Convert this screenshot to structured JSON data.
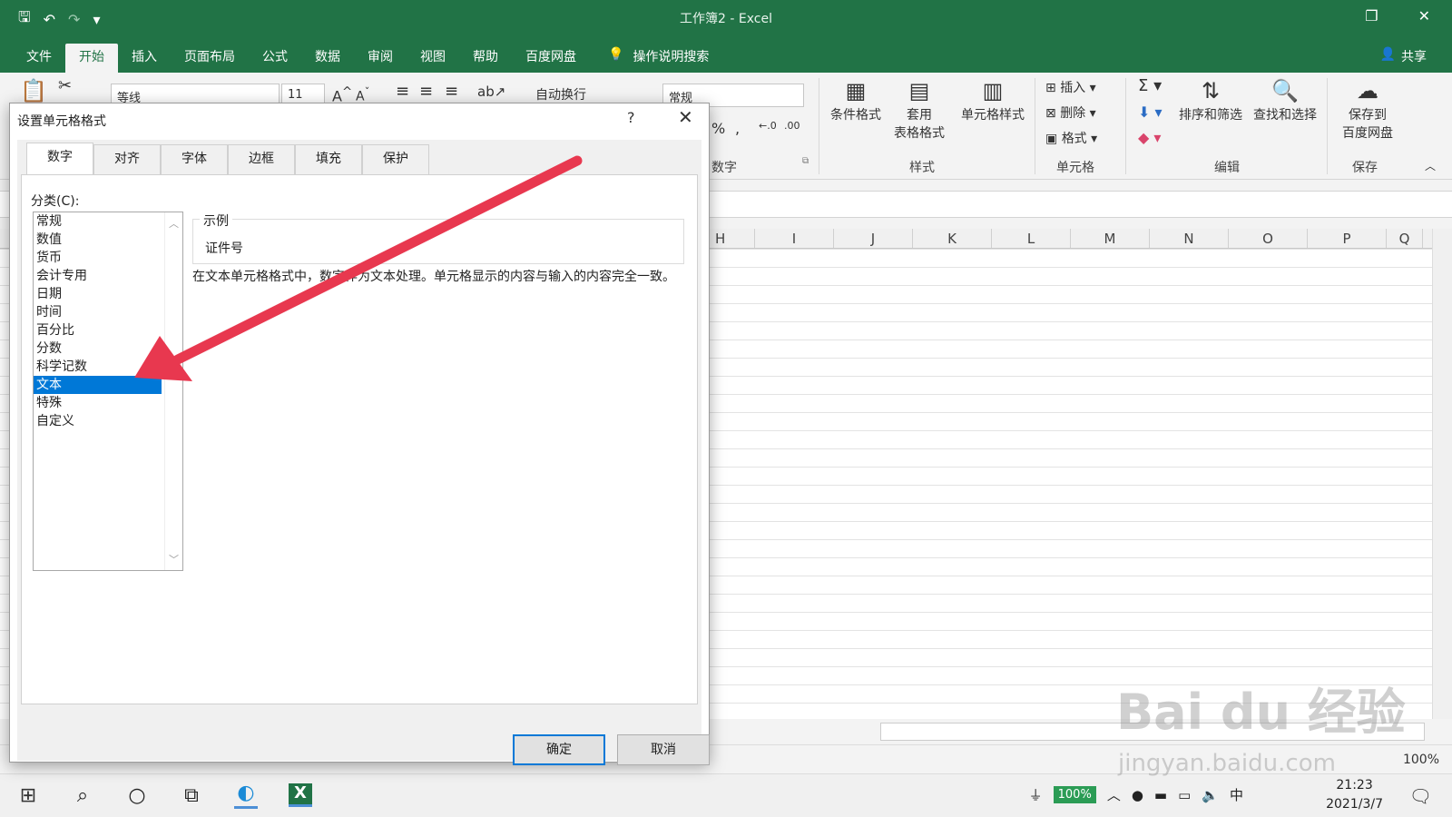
{
  "window": {
    "title": "工作簿2 - Excel"
  },
  "qat": {
    "save": "🖫",
    "undo": "↶",
    "redo": "↷",
    "more": "▾"
  },
  "menu": {
    "tabs": [
      "文件",
      "开始",
      "插入",
      "页面布局",
      "公式",
      "数据",
      "审阅",
      "视图",
      "帮助",
      "百度网盘"
    ],
    "active": "开始",
    "tell_me": "操作说明搜索",
    "share": "共享"
  },
  "ribbon": {
    "font_name": "等线",
    "font_size": "11",
    "wrap_text": "自动换行",
    "number_format": "常规",
    "number_group": "数字",
    "conditional_format": "条件格式",
    "table_format_1": "套用",
    "table_format_2": "表格格式",
    "cell_styles": "单元格样式",
    "styles_group": "样式",
    "insert": "插入",
    "delete": "删除",
    "format": "格式",
    "cells_group": "单元格",
    "sort_filter": "排序和筛选",
    "find_select": "查找和选择",
    "editing_group": "编辑",
    "save_baidu_1": "保存到",
    "save_baidu_2": "百度网盘",
    "save_group": "保存"
  },
  "sheet": {
    "columns": [
      "H",
      "I",
      "J",
      "K",
      "L",
      "M",
      "N",
      "O",
      "P",
      "Q"
    ],
    "zoom": "100%"
  },
  "dialog": {
    "title": "设置单元格格式",
    "help": "?",
    "tabs": [
      "数字",
      "对齐",
      "字体",
      "边框",
      "填充",
      "保护"
    ],
    "active_tab": "数字",
    "category_label": "分类(C):",
    "categories": [
      "常规",
      "数值",
      "货币",
      "会计专用",
      "日期",
      "时间",
      "百分比",
      "分数",
      "科学记数",
      "文本",
      "特殊",
      "自定义"
    ],
    "selected_category": "文本",
    "sample_label": "示例",
    "sample_value": "证件号",
    "description": "在文本单元格格式中，数字作为文本处理。单元格显示的内容与输入的内容完全一致。",
    "ok": "确定",
    "cancel": "取消"
  },
  "taskbar": {
    "battery": "100%",
    "ime": "中",
    "time": "21:23",
    "date": "2021/3/7"
  },
  "watermark": {
    "line1": "Bai du 经验",
    "line2": "jingyan.baidu.com"
  },
  "colors": {
    "excel_green": "#217346",
    "selection_blue": "#0078d7",
    "arrow_red": "#e8384f"
  }
}
